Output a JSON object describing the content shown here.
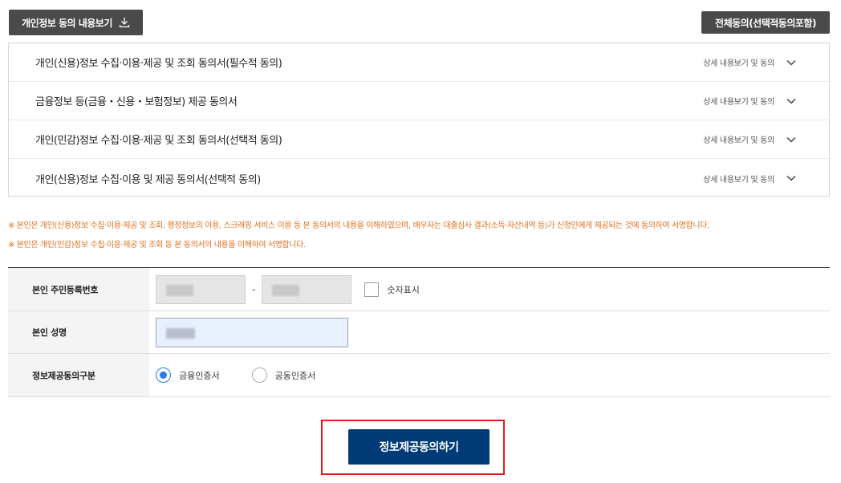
{
  "header": {
    "view_consent_label": "개인정보 동의 내용보기",
    "view_consent_icon": "download-icon",
    "agree_all_label": "전체동의(선택적동의포함)"
  },
  "consents": [
    {
      "title": "개인(신용)정보 수집·이용·제공 및 조회 동의서(필수적 동의)",
      "detail": "상세 내용보기 및 동의"
    },
    {
      "title": "금융정보 등(금융・신용・보험정보) 제공 동의서",
      "detail": "상세 내용보기 및 동의"
    },
    {
      "title": "개인(민감)정보 수집·이용·제공 및 조회 동의서(선택적 동의)",
      "detail": "상세 내용보기 및 동의"
    },
    {
      "title": "개인(신용)정보 수집·이용 및 제공 동의서(선택적 동의)",
      "detail": "상세 내용보기 및 동의"
    }
  ],
  "notices": [
    "※ 본인은 개인(신용)정보 수집·이용·제공 및 조회, 행정정보의 이용, 스크래핑 서비스 이용 등 본 동의서의 내용을 이해하였으며, 배우자는 대출심사 결과(소득·자산내역 등)가 신청인에게 제공되는 것에 동의하여 서명합니다.",
    "※ 본인은 개인(민감)정보 수집·이용·제공 및 조회 등 본 동의서의 내용을 이해하여 서명합니다."
  ],
  "form": {
    "rrn_label": "본인 주민등록번호",
    "rrn_separator": "-",
    "show_digits_label": "숫자표시",
    "name_label": "본인 성명",
    "consent_type_label": "정보제공동의구분",
    "options": [
      {
        "label": "금융인증서",
        "selected": true
      },
      {
        "label": "공동인증서",
        "selected": false
      }
    ]
  },
  "submit": {
    "label": "정보제공동의하기"
  },
  "colors": {
    "notice": "#e07020",
    "primary": "#003b78",
    "highlight_frame": "#e11d1d",
    "radio_accent": "#2a7de1"
  }
}
